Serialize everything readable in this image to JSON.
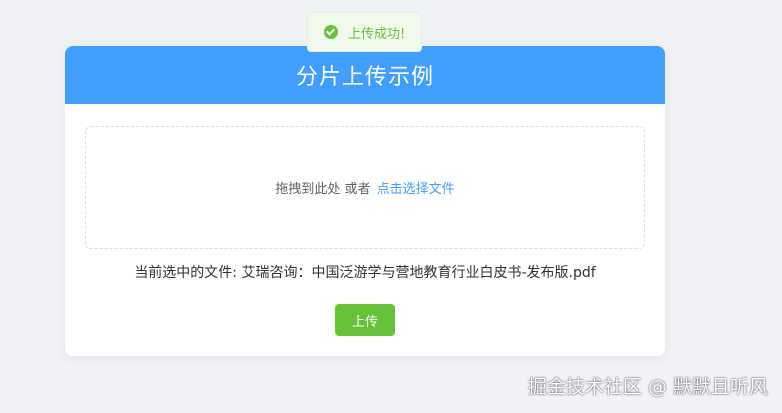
{
  "toast": {
    "icon": "check-circle-icon",
    "text": "上传成功!"
  },
  "card": {
    "title": "分片上传示例",
    "dropzone": {
      "hint": "拖拽到此处 或者",
      "link": "点击选择文件"
    },
    "current_file": {
      "label": "当前选中的文件:",
      "name": "艾瑞咨询：中国泛游学与营地教育行业白皮书-发布版.pdf"
    },
    "upload_button": "上传"
  },
  "watermark": "掘金技术社区 @ 默默且听风",
  "colors": {
    "primary": "#409eff",
    "success": "#67c23a",
    "background": "#f0f2f5"
  }
}
